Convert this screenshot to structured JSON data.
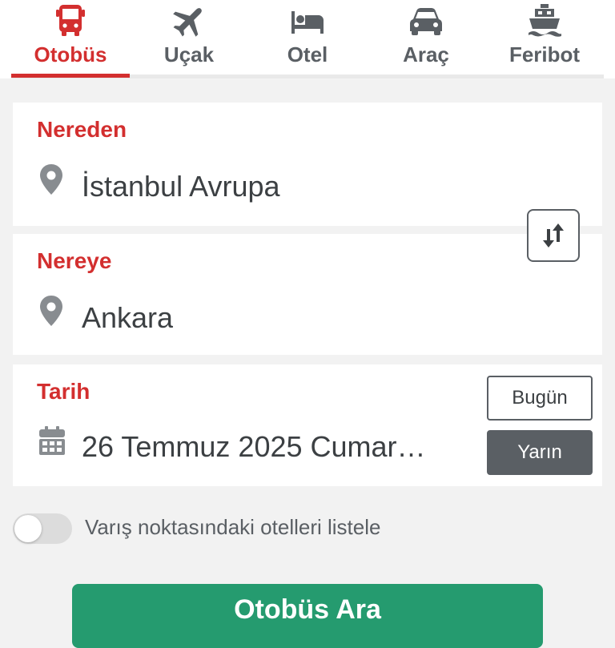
{
  "tabs": [
    {
      "label": "Otobüs",
      "icon": "bus-icon",
      "active": true
    },
    {
      "label": "Uçak",
      "icon": "airplane-icon",
      "active": false
    },
    {
      "label": "Otel",
      "icon": "bed-icon",
      "active": false
    },
    {
      "label": "Araç",
      "icon": "car-icon",
      "active": false
    },
    {
      "label": "Feribot",
      "icon": "ferry-icon",
      "active": false
    }
  ],
  "from": {
    "label": "Nereden",
    "value": "İstanbul Avrupa",
    "icon": "location-pin-icon"
  },
  "to": {
    "label": "Nereye",
    "value": "Ankara",
    "icon": "location-pin-icon"
  },
  "swap": {
    "icon": "swap-arrows-icon"
  },
  "date": {
    "label": "Tarih",
    "value": "26 Temmuz 2025 Cumar…",
    "icon": "calendar-icon",
    "today_label": "Bugün",
    "tomorrow_label": "Yarın"
  },
  "hotel_toggle": {
    "label": "Varış noktasındaki otelleri listele",
    "on": false
  },
  "search_button": {
    "label": "Otobüs Ara"
  },
  "colors": {
    "accent_red": "#d32f2f",
    "icon_gray": "#5a5f64",
    "search_green": "#259b6f",
    "background": "#f2f2f2"
  }
}
